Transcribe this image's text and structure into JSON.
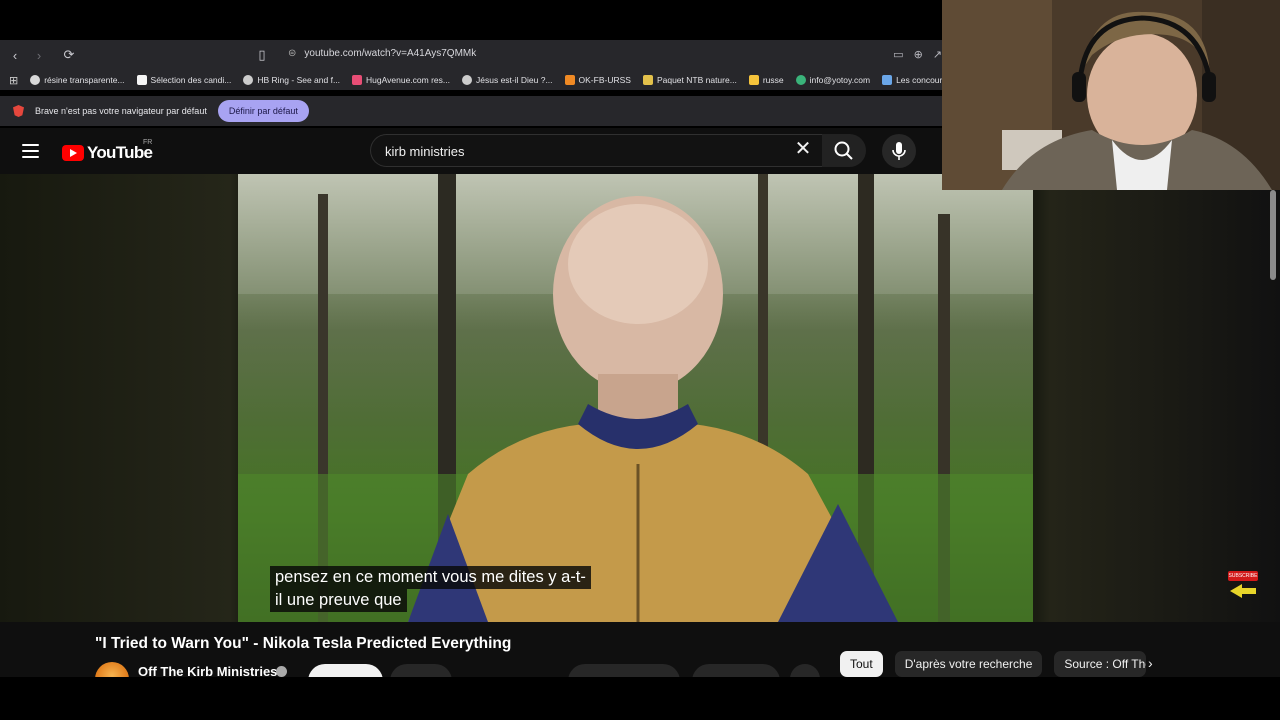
{
  "browser": {
    "url": "youtube.com/watch?v=A41Ays7QMMk",
    "bookmarks": [
      {
        "label": "résine transparente...",
        "color": "#d9d9d9"
      },
      {
        "label": "Sélection des candi...",
        "color": "#f5f5f5"
      },
      {
        "label": "HB Ring - See and f...",
        "color": "#cccccc"
      },
      {
        "label": "HugAvenue.com res...",
        "color": "#e84e76"
      },
      {
        "label": "Jésus est-il Dieu ?...",
        "color": "#cccccc"
      },
      {
        "label": "OK-FB-URSS",
        "color": "#f08a24"
      },
      {
        "label": "Paquet NTB nature...",
        "color": "#e3c14b"
      },
      {
        "label": "russe",
        "color": "#f5c33b"
      },
      {
        "label": "info@yotoy.com",
        "color": "#3ab37a"
      },
      {
        "label": "Les concours d'aute...",
        "color": "#6aa6e8"
      }
    ],
    "default_notice": "Brave n'est pas votre navigateur par défaut",
    "default_button": "Définir par défaut"
  },
  "youtube": {
    "logo_text": "YouTube",
    "region": "FR",
    "search_query": "kirb ministries",
    "video_title": "\"I Tried to Warn You\" - Nikola Tesla Predicted Everything",
    "channel_name": "Off The Kirb Ministries",
    "captions": [
      "pensez en ce moment vous me dites y a-t-",
      "il une preuve que"
    ],
    "subscribe_tag": "SUBSCRIBE",
    "chips": [
      {
        "label": "Tout",
        "active": true
      },
      {
        "label": "D'après votre recherche",
        "active": false
      },
      {
        "label": "Source : Off The",
        "active": false
      }
    ]
  },
  "colors": {
    "accent": "#ff0000",
    "chrome_bg": "#27272b",
    "yt_bg": "#0f0f0f",
    "default_btn": "#a8a3f2"
  },
  "icons": [
    "back-icon",
    "forward-icon",
    "reload-icon",
    "bookmark-icon",
    "site-info-icon",
    "apps-icon",
    "brave-icon",
    "menu-icon",
    "clear-search-icon",
    "search-icon",
    "mic-icon",
    "chevron-right-icon",
    "verified-icon"
  ]
}
